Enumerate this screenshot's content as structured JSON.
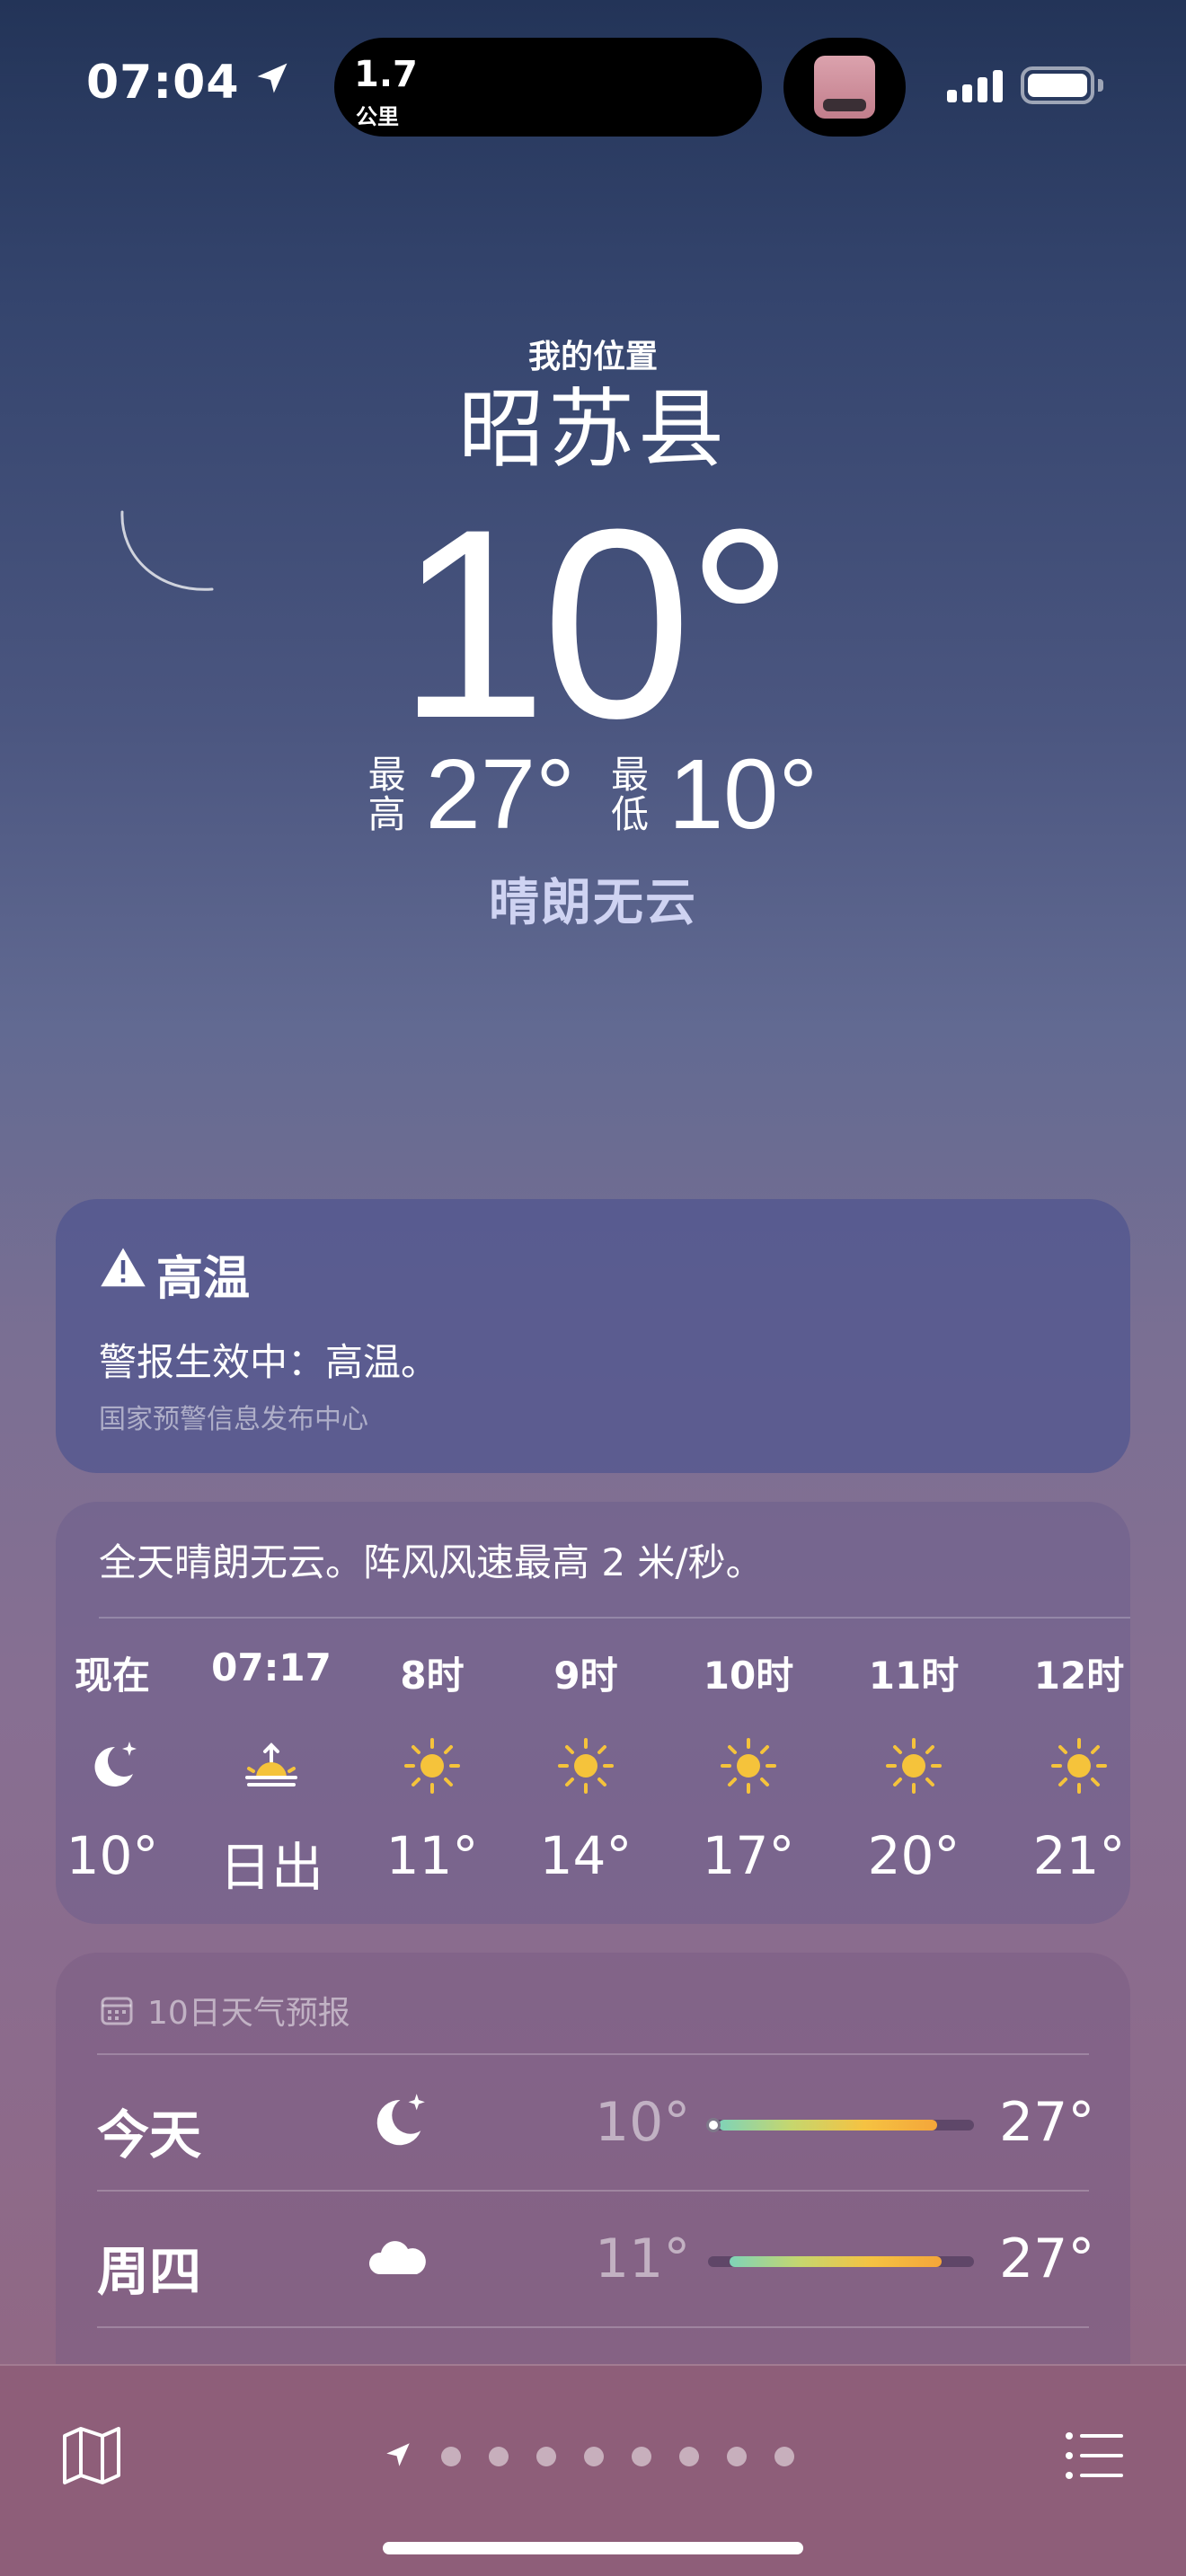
{
  "status_bar": {
    "time": "07:04",
    "island_value": "1.7",
    "island_unit": "公里"
  },
  "header": {
    "my_location": "我的位置",
    "city": "昭苏县",
    "temperature": "10°",
    "high_label_1": "最",
    "high_label_2": "高",
    "high_value": "27°",
    "low_label_1": "最",
    "low_label_2": "低",
    "low_value": "10°",
    "condition": "晴朗无云"
  },
  "alert": {
    "title": "高温",
    "text": "警报生效中：高温。",
    "source": "国家预警信息发布中心",
    "icon": "warning-triangle-icon"
  },
  "hourly": {
    "summary": "全天晴朗无云。阵风风速最高 2 米/秒。",
    "items": [
      {
        "label": "现在",
        "icon": "moon-stars-icon",
        "temp": "10°"
      },
      {
        "label": "07:17",
        "icon": "sunrise-icon",
        "temp": "日出"
      },
      {
        "label": "8时",
        "icon": "sun-icon",
        "temp": "11°"
      },
      {
        "label": "9时",
        "icon": "sun-icon",
        "temp": "14°"
      },
      {
        "label": "10时",
        "icon": "sun-icon",
        "temp": "17°"
      },
      {
        "label": "11时",
        "icon": "sun-icon",
        "temp": "20°"
      },
      {
        "label": "12时",
        "icon": "sun-icon",
        "temp": "21°"
      }
    ]
  },
  "forecast": {
    "title": "10日天气预报",
    "days": [
      {
        "day": "今天",
        "icon": "moon-stars-icon",
        "low": "10°",
        "high": "27°",
        "bar_start": 0.04,
        "bar_end": 0.86,
        "current_marker": 0.02
      },
      {
        "day": "周四",
        "icon": "cloud-icon",
        "low": "11°",
        "high": "27°",
        "bar_start": 0.08,
        "bar_end": 0.88
      }
    ]
  },
  "bottom_bar": {
    "page_count": 8,
    "active_page": 0
  },
  "colors": {
    "sun": "#f5c33b",
    "bar_gradient_start": "#7fd3b8",
    "bar_gradient_end": "#f4a63a"
  }
}
